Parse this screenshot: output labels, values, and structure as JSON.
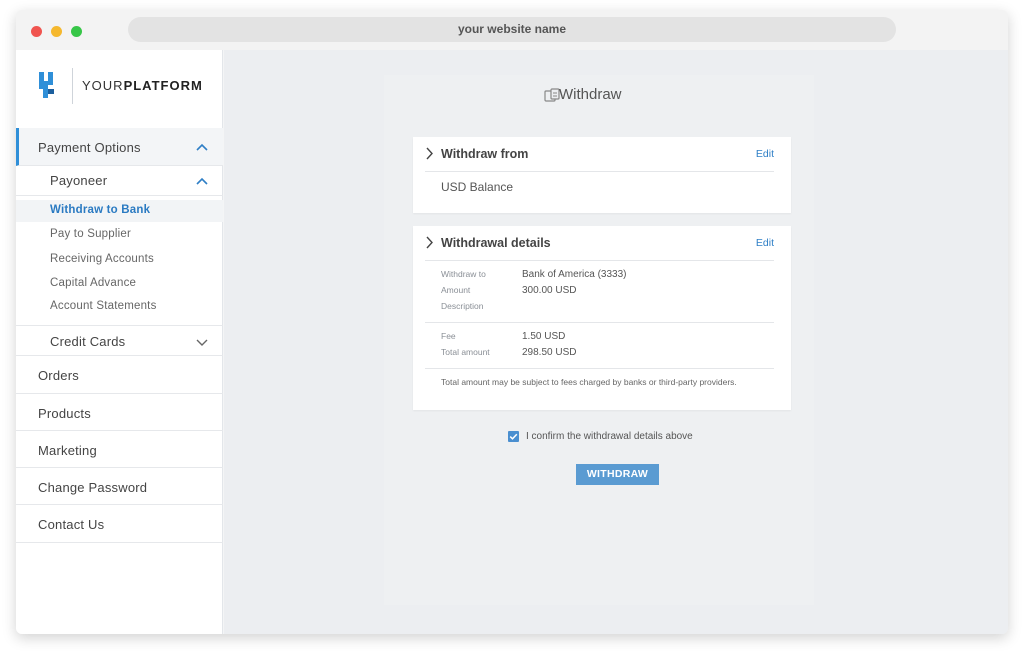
{
  "browser": {
    "url": "your website name"
  },
  "logo": {
    "prefix": "YOUR",
    "bold": "PLATFORM"
  },
  "sidebar": {
    "payment_options": "Payment Options",
    "payoneer": "Payoneer",
    "payoneer_items": [
      {
        "label": "Withdraw to Bank",
        "selected": true
      },
      {
        "label": "Pay to Supplier"
      },
      {
        "label": "Receiving Accounts"
      },
      {
        "label": "Capital Advance"
      },
      {
        "label": "Account Statements"
      }
    ],
    "credit_cards": "Credit Cards",
    "items": [
      "Orders",
      "Products",
      "Marketing",
      "Change Password",
      "Contact Us"
    ]
  },
  "main": {
    "title": "Withdraw",
    "withdraw_from": {
      "title": "Withdraw from",
      "edit": "Edit",
      "value": "USD Balance"
    },
    "details": {
      "title": "Withdrawal details",
      "edit": "Edit",
      "rows": [
        {
          "key": "Withdraw to",
          "value": "Bank of America (3333)"
        },
        {
          "key": "Amount",
          "value": "300.00 USD"
        },
        {
          "key": "Description",
          "value": ""
        },
        {
          "key": "Fee",
          "value": "1.50 USD"
        },
        {
          "key": "Total amount",
          "value": "298.50 USD"
        }
      ],
      "note": "Total amount may be subject to fees charged by banks or third-party providers."
    },
    "confirm_label": "I confirm the withdrawal details above",
    "confirm_checked": true,
    "button": "WITHDRAW"
  },
  "colors": {
    "accent": "#2f8fd8",
    "button": "#5a9bd2",
    "link": "#2f7fc6"
  }
}
